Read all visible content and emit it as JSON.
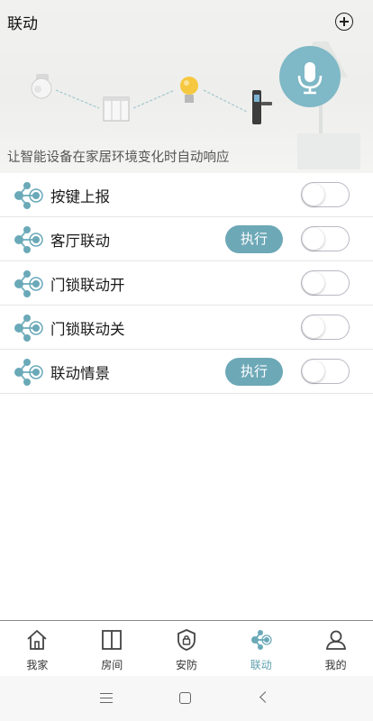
{
  "header": {
    "title": "联动",
    "add_icon": "plus-circle-icon",
    "mic_icon": "microphone-icon"
  },
  "hero": {
    "description": "让智能设备在家居环境变化时自动响应",
    "devices": [
      "motion-sensor-icon",
      "window-curtain-icon",
      "light-bulb-icon",
      "door-lock-icon"
    ]
  },
  "rules": [
    {
      "label": "按键上报",
      "execute_label": "",
      "enabled": false
    },
    {
      "label": "客厅联动",
      "execute_label": "执行",
      "enabled": false
    },
    {
      "label": "门锁联动开",
      "execute_label": "",
      "enabled": false
    },
    {
      "label": "门锁联动关",
      "execute_label": "",
      "enabled": false
    },
    {
      "label": "联动情景",
      "execute_label": "执行",
      "enabled": false
    }
  ],
  "tabs": [
    {
      "label": "我家",
      "icon": "home-icon",
      "active": false
    },
    {
      "label": "房间",
      "icon": "room-door-icon",
      "active": false
    },
    {
      "label": "安防",
      "icon": "security-shield-icon",
      "active": false
    },
    {
      "label": "联动",
      "icon": "linkage-nodes-icon",
      "active": true
    },
    {
      "label": "我的",
      "icon": "profile-icon",
      "active": false
    }
  ],
  "colors": {
    "accent": "#6da8b7",
    "mic_bg": "#7fb8c6",
    "active_tab": "#5fa1b0"
  }
}
